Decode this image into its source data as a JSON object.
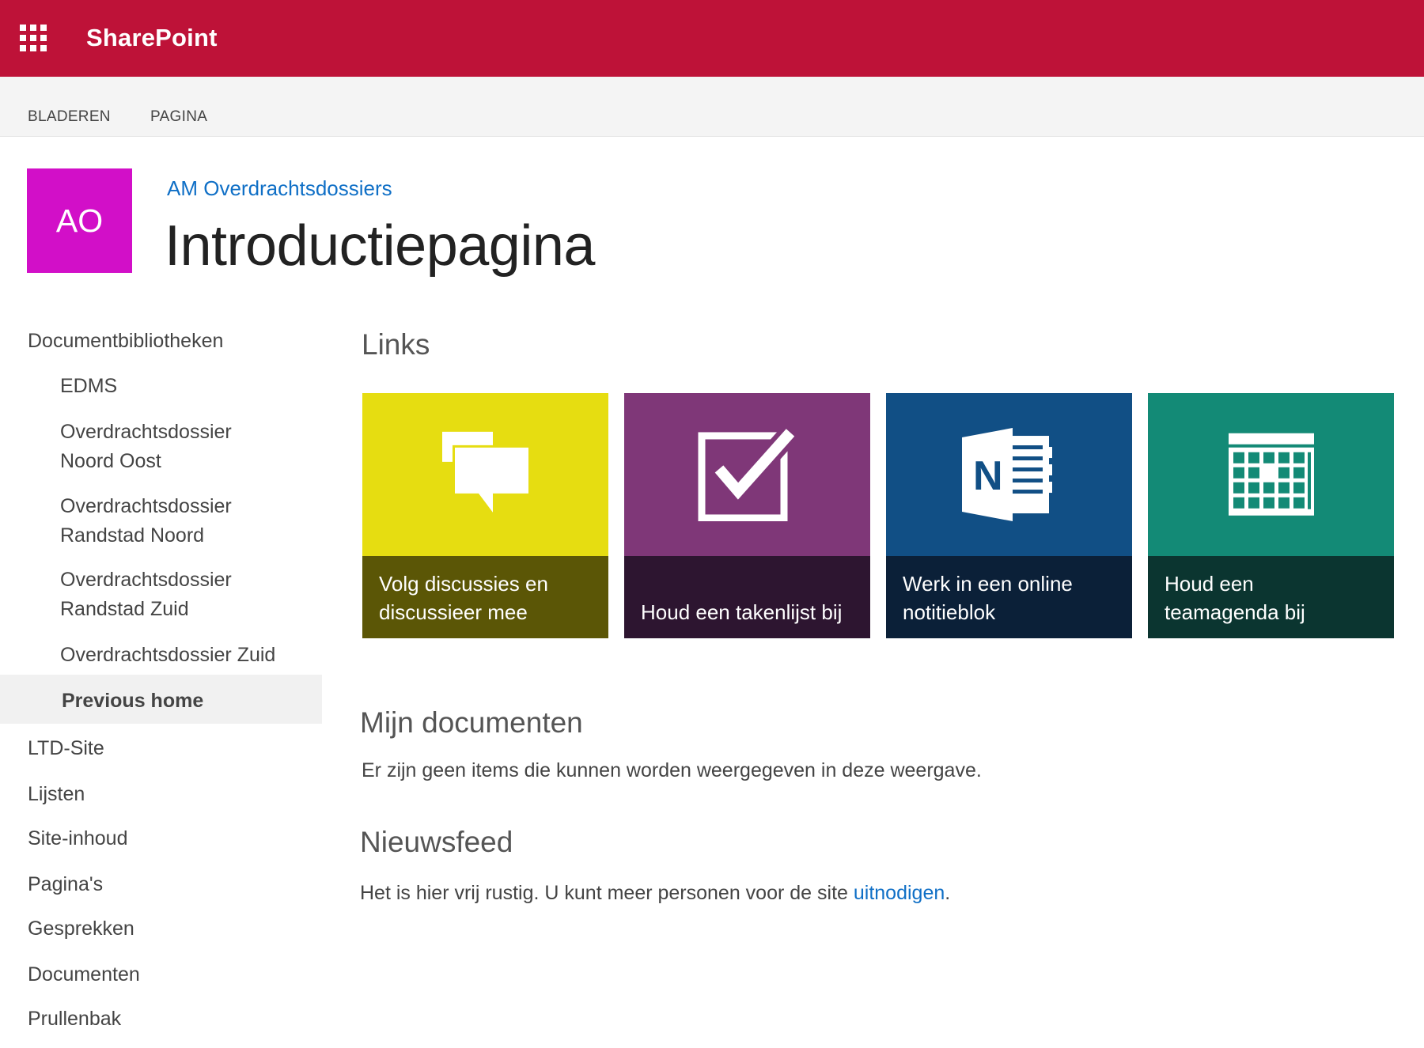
{
  "suite": {
    "brand": "SharePoint",
    "color": "#be1238"
  },
  "ribbon": {
    "tabs": [
      "BLADEREN",
      "PAGINA"
    ]
  },
  "site": {
    "logo_initials": "AO",
    "logo_color": "#d20fc8",
    "title": "AM Overdrachtsdossiers",
    "page_title": "Introductiepagina"
  },
  "nav": {
    "items": [
      {
        "label": "Documentbibliotheken"
      },
      {
        "label": "EDMS"
      },
      {
        "label": "Overdrachtsdossier",
        "label2": "Noord Oost"
      },
      {
        "label": "Overdrachtsdossier",
        "label2": "Randstad Noord"
      },
      {
        "label": "Overdrachtsdossier",
        "label2": "Randstad Zuid"
      },
      {
        "label": "Overdrachtsdossier Zuid"
      },
      {
        "label": "Previous home",
        "selected": true
      },
      {
        "label": "LTD-Site"
      },
      {
        "label": "Lijsten"
      },
      {
        "label": "Site-inhoud"
      },
      {
        "label": "Pagina's"
      },
      {
        "label": "Gesprekken"
      },
      {
        "label": "Documenten"
      },
      {
        "label": "Prullenbak"
      }
    ]
  },
  "main": {
    "links_heading": "Links",
    "tiles": [
      {
        "line1": "Volg discussies en",
        "line2": "discussieer mee",
        "icon": "chat-bubbles-icon",
        "color_top": "#e6dd11",
        "color_bottom": "#5b5606"
      },
      {
        "line1": "",
        "line2": "Houd een takenlijst bij",
        "icon": "checkbox-icon",
        "color_top": "#7f3778",
        "color_bottom": "#2d1530"
      },
      {
        "line1": "Werk in een online",
        "line2": "notitieblok",
        "icon": "onenote-icon",
        "color_top": "#114f85",
        "color_bottom": "#0b2038"
      },
      {
        "line1": "Houd een",
        "line2": "teamagenda bij",
        "icon": "calendar-icon",
        "color_top": "#138a76",
        "color_bottom": "#0b3530"
      }
    ],
    "documents_heading": "Mijn documenten",
    "documents_empty": "Er zijn geen items die kunnen worden weergegeven in deze weergave.",
    "newsfeed_heading": "Nieuwsfeed",
    "newsfeed_text": "Het is hier vrij rustig. U kunt meer personen voor de site",
    "newsfeed_link": "uitnodigen",
    "newsfeed_end": "."
  }
}
